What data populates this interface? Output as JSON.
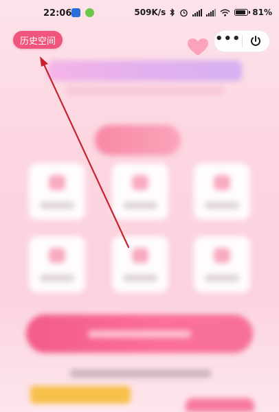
{
  "status_bar": {
    "time": "22:06",
    "net_speed": "509K/s",
    "battery": "81%",
    "icons": [
      "app-notification-icon",
      "app-download-icon",
      "bluetooth-icon",
      "alarm-icon",
      "signal-icon",
      "signal-icon",
      "wifi-icon",
      "battery-icon"
    ]
  },
  "header": {
    "history_label": "历史空间",
    "more_icon": "more-icon",
    "close_icon": "power-icon",
    "heart_icon": "heart-icon"
  },
  "colors": {
    "accent": "#f0557d",
    "background": "#fcd6e1"
  }
}
